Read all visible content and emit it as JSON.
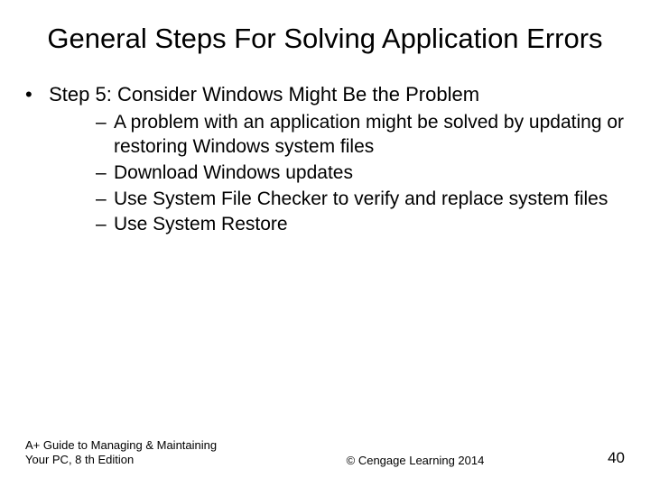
{
  "title": "General Steps For Solving Application Errors",
  "bullet": {
    "text": "Step 5: Consider Windows Might Be the Problem",
    "sub": [
      "A problem with an application might be solved by updating or restoring Windows system files",
      "Download Windows updates",
      "Use System File Checker to verify and replace system files",
      "Use System Restore"
    ]
  },
  "footer": {
    "left": "A+ Guide to Managing & Maintaining Your PC, 8 th Edition",
    "center": "© Cengage Learning 2014",
    "right": "40"
  }
}
